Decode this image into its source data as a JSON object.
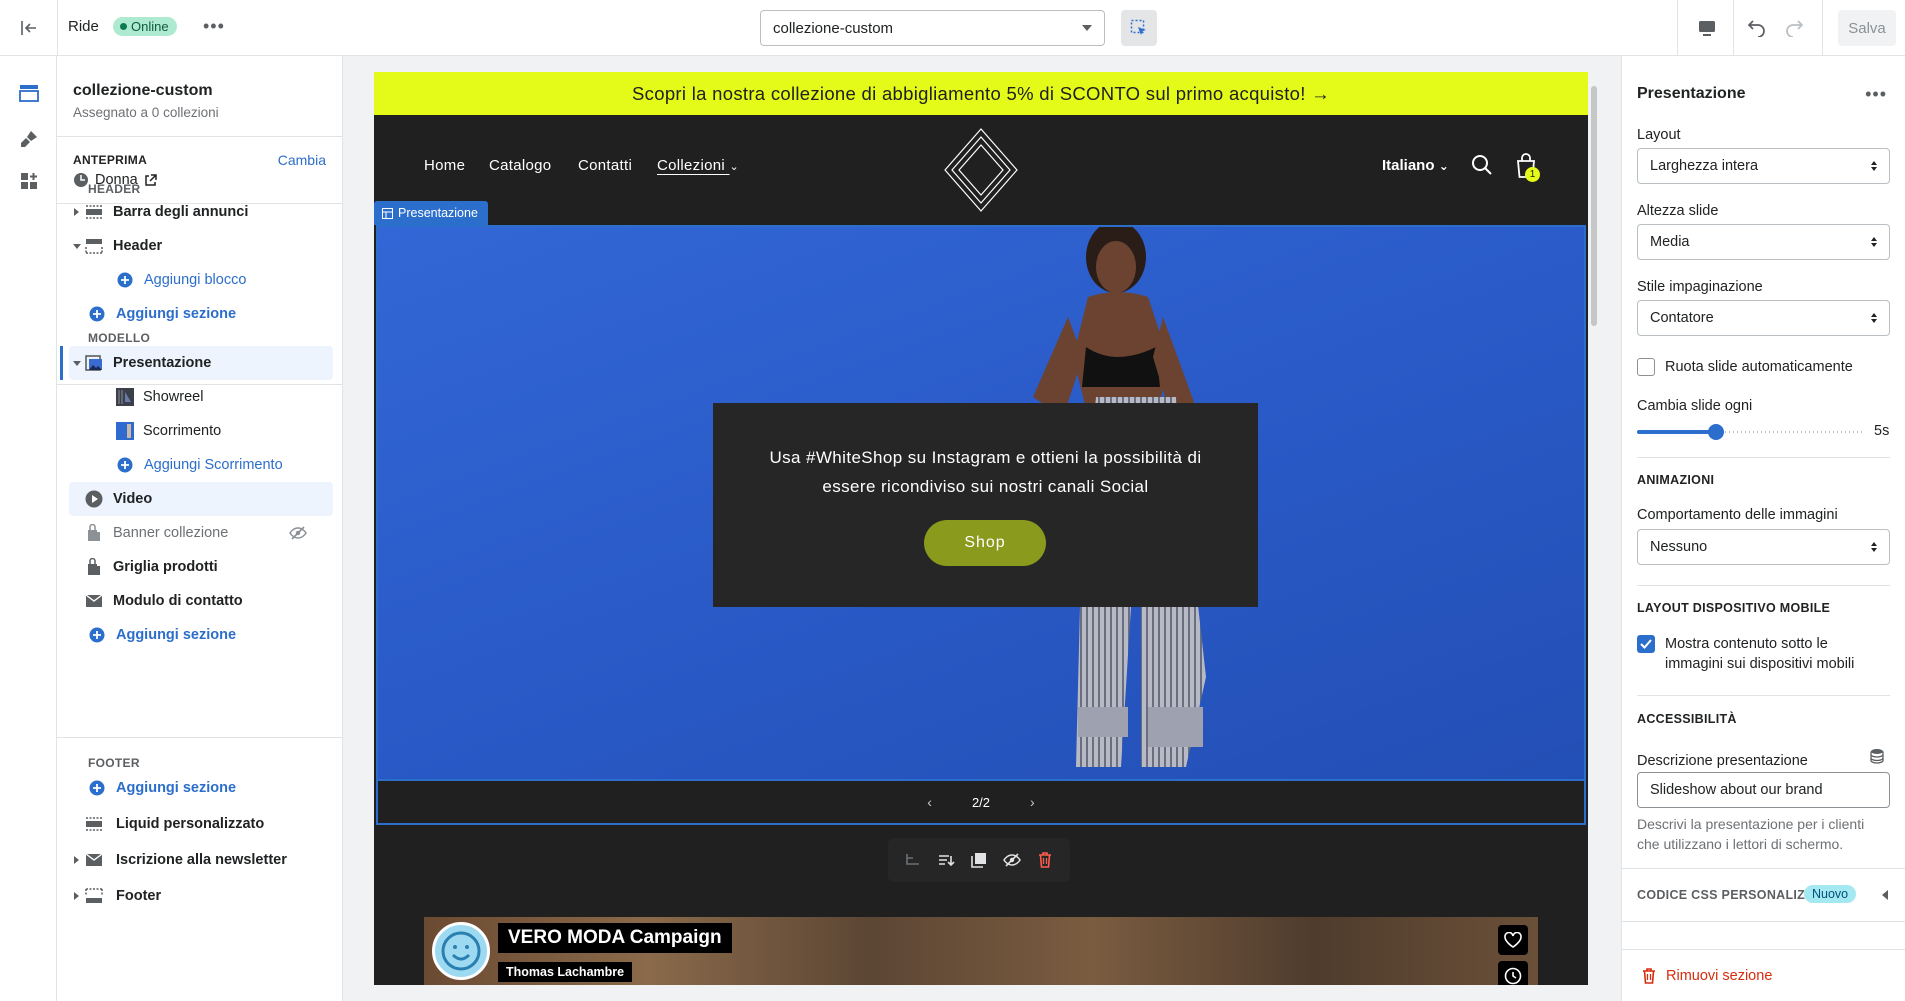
{
  "topbar": {
    "theme_name": "Ride",
    "status_badge": "Online",
    "template_value": "collezione-custom",
    "save_label": "Salva"
  },
  "sidebar": {
    "template_title": "collezione-custom",
    "template_subtitle": "Assegnato a 0 collezioni",
    "preview_label": "ANTEPRIMA",
    "preview_change": "Cambia",
    "preview_value": "Donna",
    "groups": {
      "header": "HEADER",
      "template": "MODELLO",
      "footer": "FOOTER"
    },
    "header_items": {
      "announcement": "Barra degli annunci",
      "header": "Header",
      "add_block": "Aggiungi blocco",
      "add_section": "Aggiungi sezione"
    },
    "template_items": {
      "slideshow": "Presentazione",
      "showreel": "Showreel",
      "scroll": "Scorrimento",
      "add_scroll": "Aggiungi Scorrimento",
      "video": "Video",
      "collection_banner": "Banner collezione",
      "product_grid": "Griglia prodotti",
      "contact_form": "Modulo di contatto",
      "add_section": "Aggiungi sezione"
    },
    "footer_items": {
      "add_section": "Aggiungi sezione",
      "custom_liquid": "Liquid personalizzato",
      "newsletter": "Iscrizione alla newsletter",
      "footer": "Footer"
    }
  },
  "preview": {
    "announcement": "Scopri la nostra collezione di abbigliamento 5% di SCONTO sul primo acquisto! →",
    "nav": [
      "Home",
      "Catalogo",
      "Contatti",
      "Collezioni"
    ],
    "language": "Italiano",
    "cart_count": "1",
    "section_tag": "Presentazione",
    "slide_text": "Usa #WhiteShop su Instagram e ottieni la possibilità di essere ricondiviso sui nostri canali Social",
    "slide_button": "Shop",
    "slide_counter": "2/2",
    "video_title": "VERO MODA Campaign",
    "video_author": "Thomas Lachambre"
  },
  "panel": {
    "title": "Presentazione",
    "layout_label": "Layout",
    "layout_value": "Larghezza intera",
    "height_label": "Altezza slide",
    "height_value": "Media",
    "pagination_label": "Stile impaginazione",
    "pagination_value": "Contatore",
    "autorotate_label": "Ruota slide automaticamente",
    "autorotate_checked": false,
    "change_every_label": "Cambia slide ogni",
    "change_every_value": "5s",
    "change_every_fraction": 0.35,
    "animations_head": "ANIMAZIONI",
    "image_behavior_label": "Comportamento delle immagini",
    "image_behavior_value": "Nessuno",
    "mobile_head": "LAYOUT DISPOSITIVO MOBILE",
    "mobile_check_label": "Mostra contenuto sotto le immagini sui dispositivi mobili",
    "mobile_check_checked": true,
    "accessibility_head": "ACCESSIBILITÀ",
    "description_label": "Descrizione presentazione",
    "description_value": "Slideshow about our brand",
    "description_help": "Descrivi la presentazione per i clienti che utilizzano i lettori di schermo.",
    "css_head": "CODICE CSS PERSONALIZ...",
    "css_badge": "Nuovo",
    "remove_label": "Rimuovi sezione"
  },
  "colors": {
    "accent": "#2c6ecb",
    "announcement_bg": "#e4fb19",
    "store_bg": "#202020",
    "slide_button": "#8a9a1c",
    "danger": "#d72c0d"
  }
}
